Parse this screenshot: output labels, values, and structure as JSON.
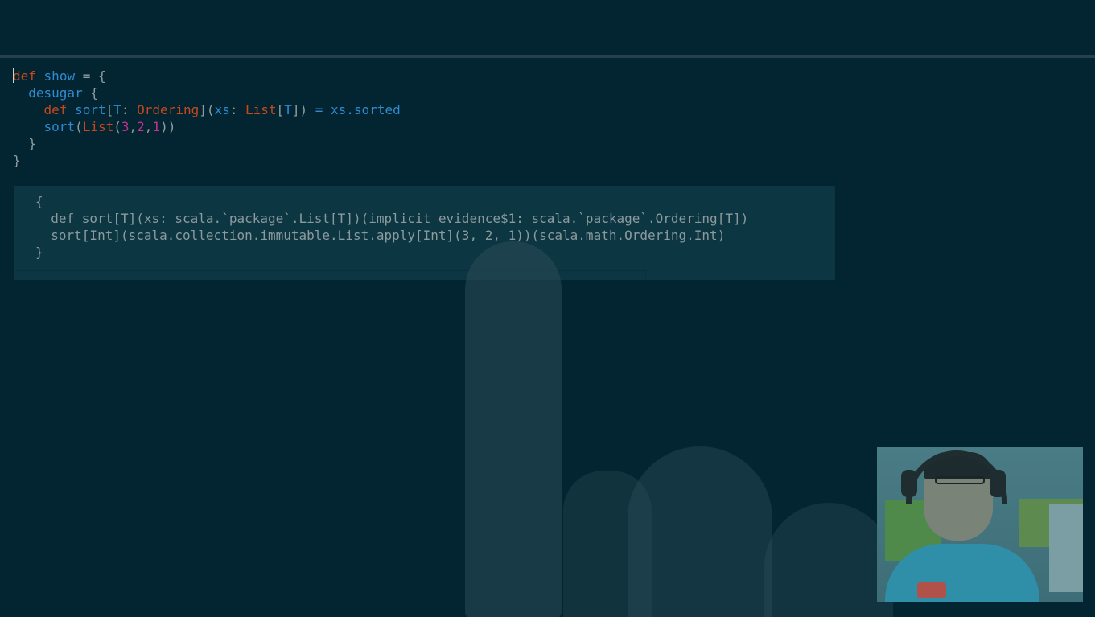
{
  "editor": {
    "lines": [
      {
        "tokens": [
          {
            "t": "def",
            "c": "kw"
          },
          {
            "t": " ",
            "c": "pn"
          },
          {
            "t": "show",
            "c": "fn"
          },
          {
            "t": " = {",
            "c": "pn"
          }
        ]
      },
      {
        "tokens": [
          {
            "t": "  ",
            "c": "pn"
          },
          {
            "t": "desugar",
            "c": "fn"
          },
          {
            "t": " {",
            "c": "pn"
          }
        ]
      },
      {
        "tokens": [
          {
            "t": "    ",
            "c": "pn"
          },
          {
            "t": "def",
            "c": "kw"
          },
          {
            "t": " ",
            "c": "pn"
          },
          {
            "t": "sort",
            "c": "fn"
          },
          {
            "t": "[",
            "c": "pn"
          },
          {
            "t": "T",
            "c": "tp"
          },
          {
            "t": ": ",
            "c": "pn"
          },
          {
            "t": "Ordering",
            "c": "ty"
          },
          {
            "t": "](",
            "c": "pn"
          },
          {
            "t": "xs",
            "c": "fn"
          },
          {
            "t": ": ",
            "c": "pn"
          },
          {
            "t": "List",
            "c": "ty"
          },
          {
            "t": "[",
            "c": "pn"
          },
          {
            "t": "T",
            "c": "tp"
          },
          {
            "t": "]) ",
            "c": "pn"
          },
          {
            "t": "=",
            "c": "fn"
          },
          {
            "t": " ",
            "c": "pn"
          },
          {
            "t": "xs.sorted",
            "c": "fn"
          }
        ]
      },
      {
        "tokens": [
          {
            "t": "    ",
            "c": "pn"
          },
          {
            "t": "sort",
            "c": "fn"
          },
          {
            "t": "(",
            "c": "pn"
          },
          {
            "t": "List",
            "c": "ty"
          },
          {
            "t": "(",
            "c": "pn"
          },
          {
            "t": "3",
            "c": "num"
          },
          {
            "t": ",",
            "c": "pn"
          },
          {
            "t": "2",
            "c": "num"
          },
          {
            "t": ",",
            "c": "pn"
          },
          {
            "t": "1",
            "c": "num"
          },
          {
            "t": "))",
            "c": "pn"
          }
        ]
      },
      {
        "tokens": [
          {
            "t": "  }",
            "c": "pn"
          }
        ]
      },
      {
        "tokens": [
          {
            "t": "}",
            "c": "pn"
          }
        ]
      }
    ]
  },
  "output": {
    "lines": [
      "{",
      "  def sort[T](xs: scala.`package`.List[T])(implicit evidence$1: scala.`package`.Ordering[T])",
      "  sort[Int](scala.collection.immutable.List.apply[Int](3, 2, 1))(scala.math.Ordering.Int)",
      "}"
    ]
  },
  "colors": {
    "background": "#022531",
    "keyword": "#c8471e",
    "identifier": "#2f8ad0",
    "number": "#c8318f",
    "plain": "#8f9ea3",
    "output_panel": "#0c3642"
  },
  "icons": {
    "webcam": "webcam-presenter-feed"
  }
}
